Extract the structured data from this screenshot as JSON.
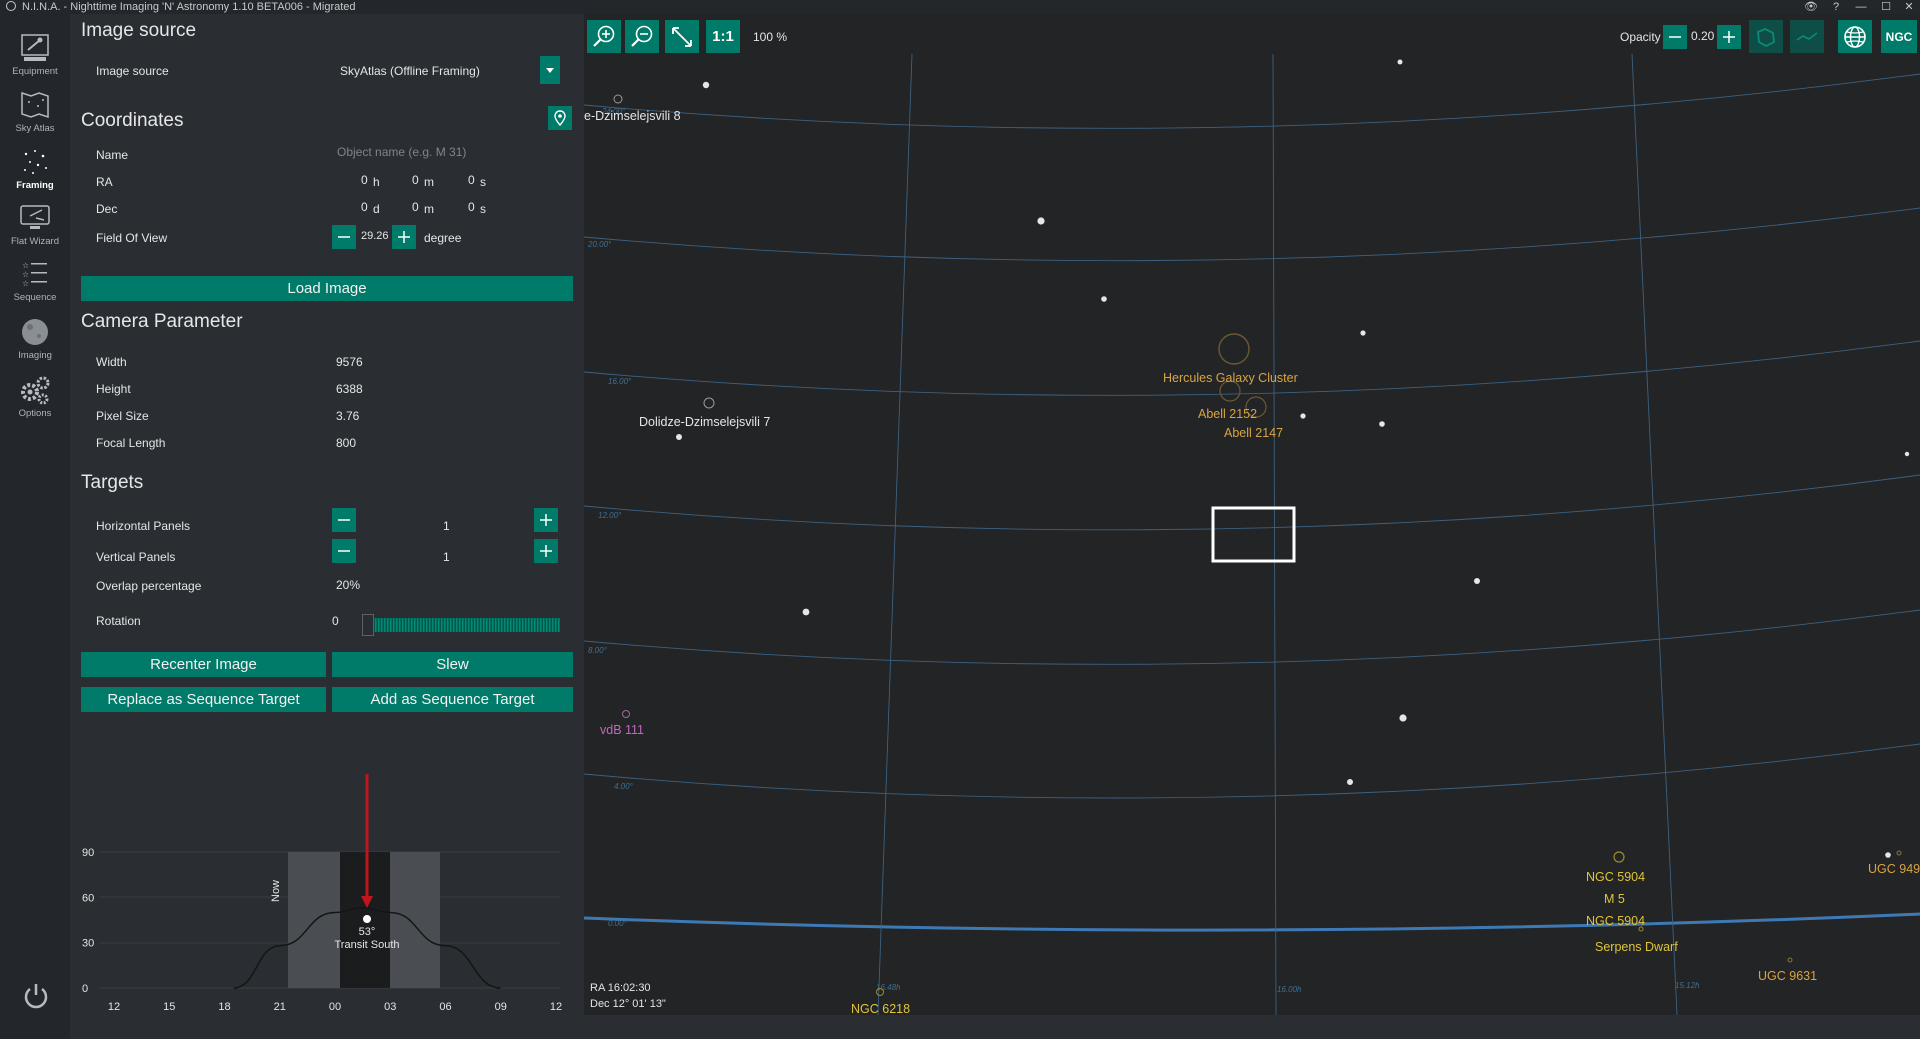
{
  "window": {
    "title": "N.I.N.A. - Nighttime Imaging 'N' Astronomy 1.10 BETA006  -  Migrated"
  },
  "nav": {
    "items": [
      {
        "label": "Equipment",
        "icon": "equipment-icon"
      },
      {
        "label": "Sky Atlas",
        "icon": "sky-atlas-icon"
      },
      {
        "label": "Framing",
        "icon": "framing-icon"
      },
      {
        "label": "Flat Wizard",
        "icon": "flat-wizard-icon"
      },
      {
        "label": "Sequence",
        "icon": "sequence-icon"
      },
      {
        "label": "Imaging",
        "icon": "imaging-icon"
      },
      {
        "label": "Options",
        "icon": "options-icon"
      }
    ],
    "active": "Framing"
  },
  "image_source": {
    "heading": "Image source",
    "label": "Image source",
    "selected": "SkyAtlas (Offline Framing)"
  },
  "coordinates": {
    "heading": "Coordinates",
    "name_label": "Name",
    "name_placeholder": "Object name (e.g. M 31)",
    "ra_label": "RA",
    "ra_h": "0",
    "ra_h_unit": "h",
    "ra_m": "0",
    "ra_m_unit": "m",
    "ra_s": "0",
    "ra_s_unit": "s",
    "dec_label": "Dec",
    "dec_d": "0",
    "dec_d_unit": "d",
    "dec_m": "0",
    "dec_m_unit": "m",
    "dec_s": "0",
    "dec_s_unit": "s",
    "fov_label": "Field Of View",
    "fov_value": "29.26",
    "fov_unit": "degree"
  },
  "load_image_label": "Load Image",
  "camera": {
    "heading": "Camera Parameter",
    "width_label": "Width",
    "width": "9576",
    "height_label": "Height",
    "height": "6388",
    "pixel_label": "Pixel Size",
    "pixel": "3.76",
    "focal_label": "Focal Length",
    "focal": "800"
  },
  "targets": {
    "heading": "Targets",
    "hpanels_label": "Horizontal Panels",
    "hpanels": "1",
    "vpanels_label": "Vertical Panels",
    "vpanels": "1",
    "overlap_label": "Overlap percentage",
    "overlap": "20%",
    "rotation_label": "Rotation",
    "rotation": "0"
  },
  "buttons": {
    "recenter": "Recenter Image",
    "slew": "Slew",
    "replace": "Replace as Sequence Target",
    "add": "Add as Sequence Target"
  },
  "chart_data": {
    "type": "area",
    "y_ticks": [
      "90",
      "60",
      "30",
      "0"
    ],
    "ylim": [
      0,
      90
    ],
    "x_ticks": [
      "12",
      "15",
      "18",
      "21",
      "00",
      "03",
      "06",
      "09",
      "12"
    ],
    "now_label": "Now",
    "transit_alt": "53°",
    "transit_label": "Transit South",
    "series": [
      {
        "x": [
          "18:30",
          "21",
          "00",
          "01:30",
          "03",
          "06",
          "09"
        ],
        "values": [
          0,
          28,
          50,
          53,
          50,
          28,
          0
        ]
      }
    ]
  },
  "sky": {
    "zoom": "100 %",
    "one_to_one": "1:1",
    "opacity_label": "Opacity",
    "opacity": "0.20",
    "ngc_label": "NGC",
    "ra_readout": "RA  16:02:30",
    "dec_readout": "Dec  12° 01' 13\"",
    "dec_grid": [
      "24.00°",
      "20.00°",
      "16.00°",
      "12.00°",
      "8.00°",
      "4.00°",
      "0.00°"
    ],
    "ra_grid": [
      "16.48h",
      "16.00h",
      "15.12h"
    ],
    "objects": [
      {
        "name": "e-Dzimselejsvili 8",
        "color": "#e6e6e6"
      },
      {
        "name": "Dolidze-Dzimselejsvili 7",
        "color": "#e6e6e6"
      },
      {
        "name": "Hercules Galaxy Cluster",
        "color": "#d9a441"
      },
      {
        "name": "Abell 2152",
        "color": "#d9a441"
      },
      {
        "name": "Abell 2147",
        "color": "#d9a441"
      },
      {
        "name": "vdB 111",
        "color": "#c266c2"
      },
      {
        "name": "NGC 5904",
        "color": "#e0c43a"
      },
      {
        "name": "M 5",
        "color": "#e0c43a"
      },
      {
        "name": "NGC 5904",
        "color": "#e0c43a"
      },
      {
        "name": "Serpens Dwarf",
        "color": "#e0c43a"
      },
      {
        "name": "UGC 949",
        "color": "#d9a441"
      },
      {
        "name": "UGC 9631",
        "color": "#d9a441"
      },
      {
        "name": "NGC 6218",
        "color": "#e0c43a"
      }
    ]
  }
}
